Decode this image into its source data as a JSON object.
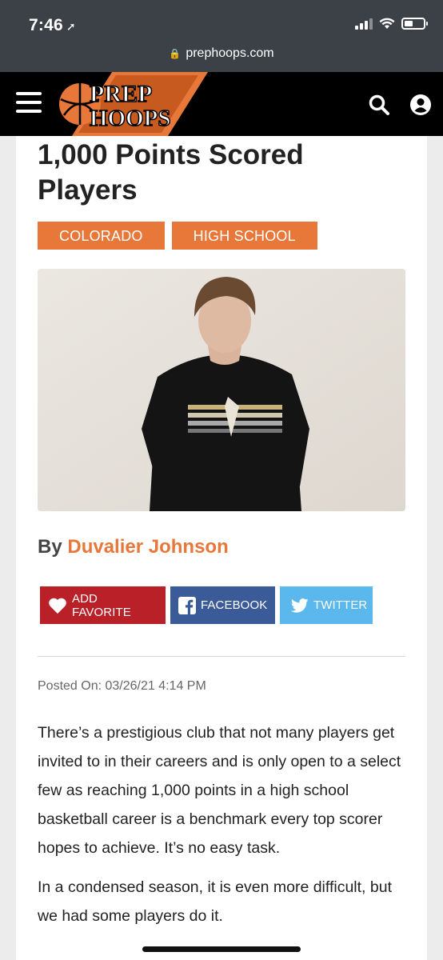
{
  "status_bar": {
    "time": "7:46",
    "url": "prephoops.com"
  },
  "header": {
    "logo_line1": "PREP",
    "logo_line2": "HOOPS"
  },
  "article": {
    "title_line1": "1,000 Points Scored",
    "title_line2": "Players",
    "tags": [
      "COLORADO",
      "HIGH SCHOOL"
    ],
    "byline_prefix": "By",
    "author": "Duvalier Johnson",
    "share": {
      "favorite": "ADD FAVORITE",
      "facebook": "FACEBOOK",
      "twitter": "TWITTER"
    },
    "posted": "Posted On: 03/26/21 4:14 PM",
    "paragraphs": [
      "There’s a prestigious club that not many players get invited to in their careers and is only open to a select few as reaching 1,000 points in a high school basketball career is a benchmark every top scorer hopes to achieve. It’s no easy task.",
      "In a condensed season, it is even more difficult, but we had some players do it."
    ]
  },
  "colors": {
    "accent": "#e8773a",
    "favorite": "#b92028",
    "facebook": "#3b5a98",
    "twitter": "#5bb8ec"
  }
}
